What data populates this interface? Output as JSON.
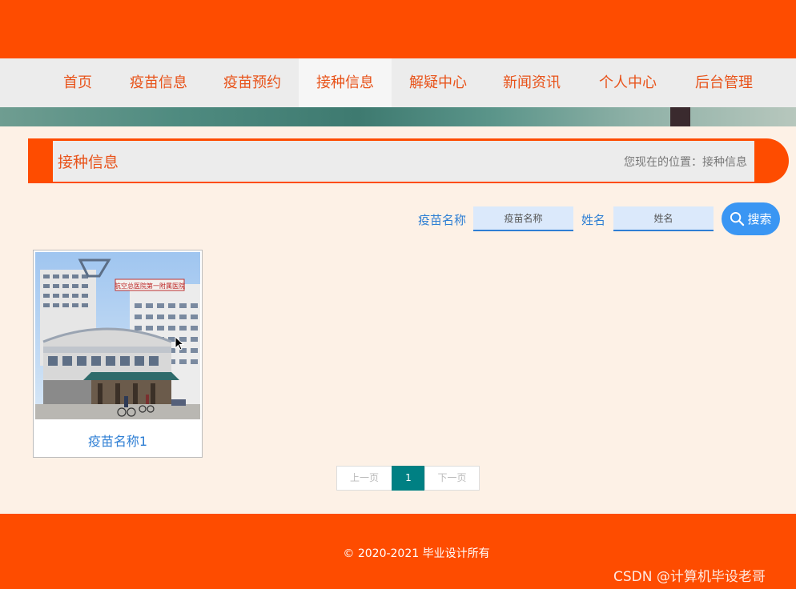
{
  "nav": {
    "items": [
      {
        "label": "首页"
      },
      {
        "label": "疫苗信息"
      },
      {
        "label": "疫苗预约"
      },
      {
        "label": "接种信息"
      },
      {
        "label": "解疑中心"
      },
      {
        "label": "新闻资讯"
      },
      {
        "label": "个人中心"
      },
      {
        "label": "后台管理"
      }
    ],
    "active": "接种信息"
  },
  "page": {
    "title": "接种信息",
    "breadcrumb": "您现在的位置：接种信息"
  },
  "search": {
    "vaccine_label": "疫苗名称",
    "vaccine_placeholder": "疫苗名称",
    "name_label": "姓名",
    "name_placeholder": "姓名",
    "button_label": "搜索"
  },
  "cards": [
    {
      "caption": "疫苗名称1",
      "image": "hospital-building-photo",
      "sign_text": "航空总医院第一附属医院"
    }
  ],
  "pagination": {
    "prev_label": "上一页",
    "current": "1",
    "next_label": "下一页"
  },
  "footer": {
    "copyright": "© 2020-2021 毕业设计所有"
  },
  "watermark": "CSDN @计算机毕设老哥",
  "colors": {
    "brand": "#fe4c00",
    "nav_bg": "#ececec",
    "link_blue": "#2f7fd4",
    "search_button": "#3a96f3",
    "pager_active": "#008083",
    "page_bg": "#fdf1e6"
  }
}
